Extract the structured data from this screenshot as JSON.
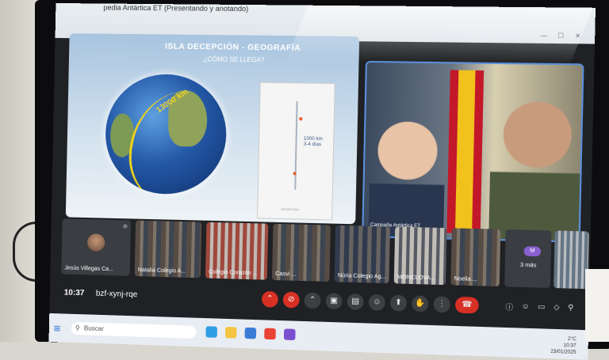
{
  "window": {
    "title": "pedia Antártica ET (Presentando y anotando)"
  },
  "slide": {
    "title": "ISLA DECEPCIÓN - GEOGRAFÍA",
    "subtitle": "¿CÓMO SE LLEGA?",
    "globe_label": "13000 km",
    "map_label_line1": "1000 km",
    "map_label_line2": "3-4 días",
    "map_footer": "ANTARTIDA"
  },
  "main_camera": {
    "name": "Campaña Antártica ET"
  },
  "participants": [
    {
      "label": "Jesús Villegas Ca..."
    },
    {
      "label": "Natalia Colegio A..."
    },
    {
      "label": "Colegio Corazón ..."
    },
    {
      "label": "Casvi ..."
    },
    {
      "label": "Núria Colegio Ag..."
    },
    {
      "label": "MONCLOVA..."
    },
    {
      "label": "Noelia ..."
    },
    {
      "label": "3 más",
      "badge": "M"
    },
    {
      "label": ""
    }
  ],
  "toolbar": {
    "time": "10:37",
    "meeting_code": "bzf-xynj-rqe",
    "accent_red": "#d93025"
  },
  "taskbar": {
    "search_placeholder": "Buscar",
    "clock_time": "10:37",
    "clock_date": "23/01/2025",
    "weather": "2°C"
  }
}
